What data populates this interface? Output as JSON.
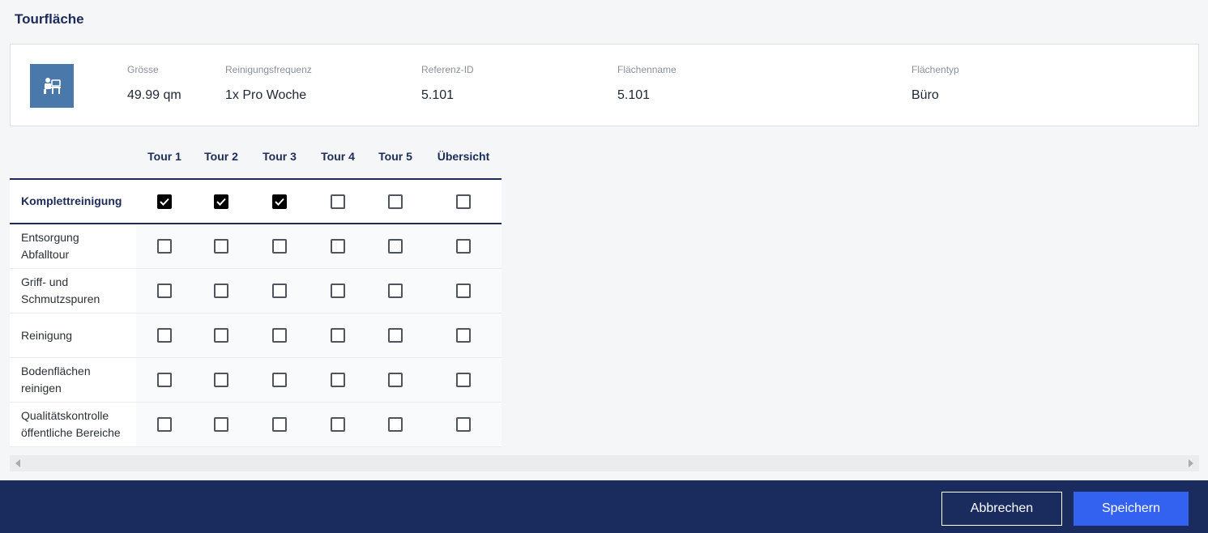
{
  "page": {
    "title": "Tourfläche"
  },
  "info": {
    "icon": "office-desk-icon",
    "fields": [
      {
        "label": "Grösse",
        "value": "49.99 qm"
      },
      {
        "label": "Reinigungsfrequenz",
        "value": "1x Pro Woche"
      },
      {
        "label": "Referenz-ID",
        "value": "5.101"
      },
      {
        "label": "Flächenname",
        "value": "5.101"
      },
      {
        "label": "Flächentyp",
        "value": "Büro"
      }
    ]
  },
  "matrix": {
    "columns": [
      "Tour 1",
      "Tour 2",
      "Tour 3",
      "Tour 4",
      "Tour 5",
      "Übersicht"
    ],
    "rows": [
      {
        "label": "Komplettreinigung",
        "checks": [
          true,
          true,
          true,
          false,
          false,
          false
        ]
      },
      {
        "label": "Entsorgung Abfalltour",
        "checks": [
          false,
          false,
          false,
          false,
          false,
          false
        ]
      },
      {
        "label": "Griff- und Schmutzspuren",
        "checks": [
          false,
          false,
          false,
          false,
          false,
          false
        ]
      },
      {
        "label": "Reinigung",
        "checks": [
          false,
          false,
          false,
          false,
          false,
          false
        ]
      },
      {
        "label": "Bodenflächen reinigen",
        "checks": [
          false,
          false,
          false,
          false,
          false,
          false
        ]
      },
      {
        "label": "Qualitätskontrolle öffentliche Bereiche",
        "checks": [
          false,
          false,
          false,
          false,
          false,
          false
        ]
      }
    ]
  },
  "footer": {
    "cancel_label": "Abbrechen",
    "save_label": "Speichern"
  },
  "colors": {
    "footer_bg": "#1a2b5e",
    "primary": "#3462f0",
    "icon_bg": "#4a78ab",
    "title": "#1c2b57"
  }
}
